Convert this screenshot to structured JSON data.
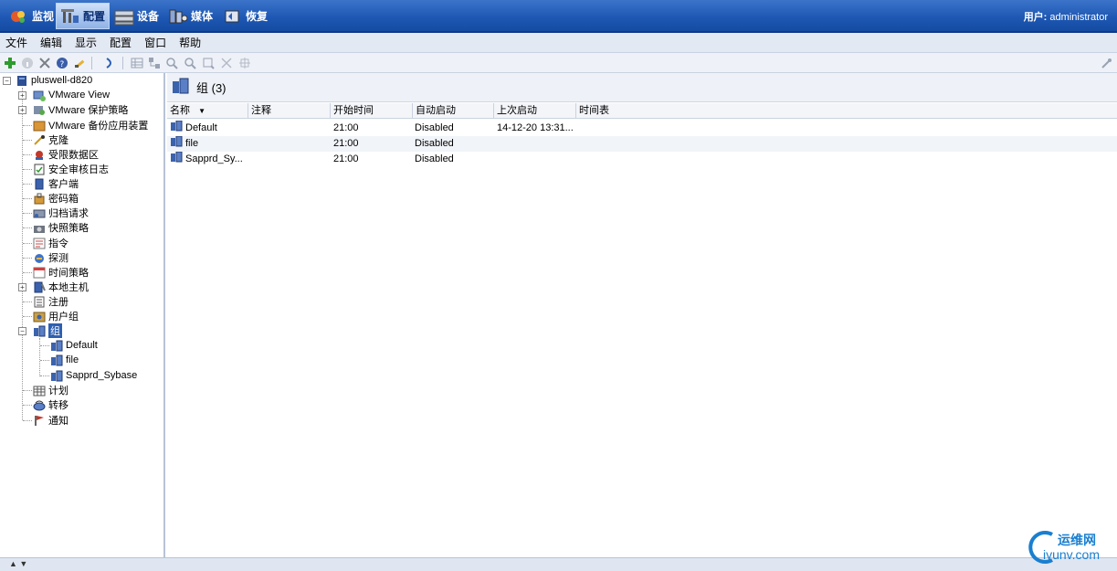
{
  "nav": {
    "items": [
      {
        "label": "监视",
        "icon": "monitor-icon"
      },
      {
        "label": "配置",
        "icon": "config-icon",
        "active": true
      },
      {
        "label": "设备",
        "icon": "devices-icon"
      },
      {
        "label": "媒体",
        "icon": "media-icon"
      },
      {
        "label": "恢复",
        "icon": "restore-icon"
      }
    ],
    "user_label": "用户:",
    "user_name": "administrator"
  },
  "menu": {
    "items": [
      "文件",
      "编辑",
      "显示",
      "配置",
      "窗口",
      "帮助"
    ]
  },
  "toolbar": {
    "icons": [
      "add-icon",
      "info-icon",
      "delete-icon",
      "help-icon",
      "search-icon",
      "refresh-icon",
      "list-view-icon",
      "tree-view-icon",
      "zoom-in-icon",
      "zoom-out-icon",
      "zoom-fit-icon",
      "expand-icon",
      "collapse-icon",
      "settings-icon"
    ]
  },
  "tree": {
    "root": "pluswell-d820",
    "items": [
      {
        "label": "VMware View",
        "expandable": true
      },
      {
        "label": "VMware 保护策略",
        "expandable": true
      },
      {
        "label": "VMware 备份应用装置",
        "expandable": false
      },
      {
        "label": "克隆",
        "expandable": false
      },
      {
        "label": "受限数据区",
        "expandable": false
      },
      {
        "label": "安全审核日志",
        "expandable": false
      },
      {
        "label": "客户端",
        "expandable": false
      },
      {
        "label": "密码箱",
        "expandable": false
      },
      {
        "label": "归档请求",
        "expandable": false
      },
      {
        "label": "快照策略",
        "expandable": false
      },
      {
        "label": "指令",
        "expandable": false
      },
      {
        "label": "探测",
        "expandable": false
      },
      {
        "label": "时间策略",
        "expandable": false
      },
      {
        "label": "本地主机",
        "expandable": true
      },
      {
        "label": "注册",
        "expandable": false
      },
      {
        "label": "用户组",
        "expandable": false
      },
      {
        "label": "组",
        "expandable": true,
        "expanded": true,
        "selected": true
      },
      {
        "label": "计划",
        "expandable": false
      },
      {
        "label": "转移",
        "expandable": false
      },
      {
        "label": "通知",
        "expandable": false
      }
    ],
    "group_children": [
      "Default",
      "file",
      "Sapprd_Sybase"
    ]
  },
  "content": {
    "title": "组 (3)",
    "columns": [
      "名称",
      "注释",
      "开始时间",
      "自动启动",
      "上次启动",
      "时间表"
    ],
    "rows": [
      {
        "name": "Default",
        "comment": "",
        "start": "21:00",
        "autostart": "Disabled",
        "last": "14-12-20 13:31...",
        "schedule": ""
      },
      {
        "name": "file",
        "comment": "",
        "start": "21:00",
        "autostart": "Disabled",
        "last": "",
        "schedule": ""
      },
      {
        "name": "Sapprd_Sy...",
        "comment": "",
        "start": "21:00",
        "autostart": "Disabled",
        "last": "",
        "schedule": ""
      }
    ]
  },
  "watermark": {
    "cn": "运维网",
    "en": "iyunv.com"
  }
}
